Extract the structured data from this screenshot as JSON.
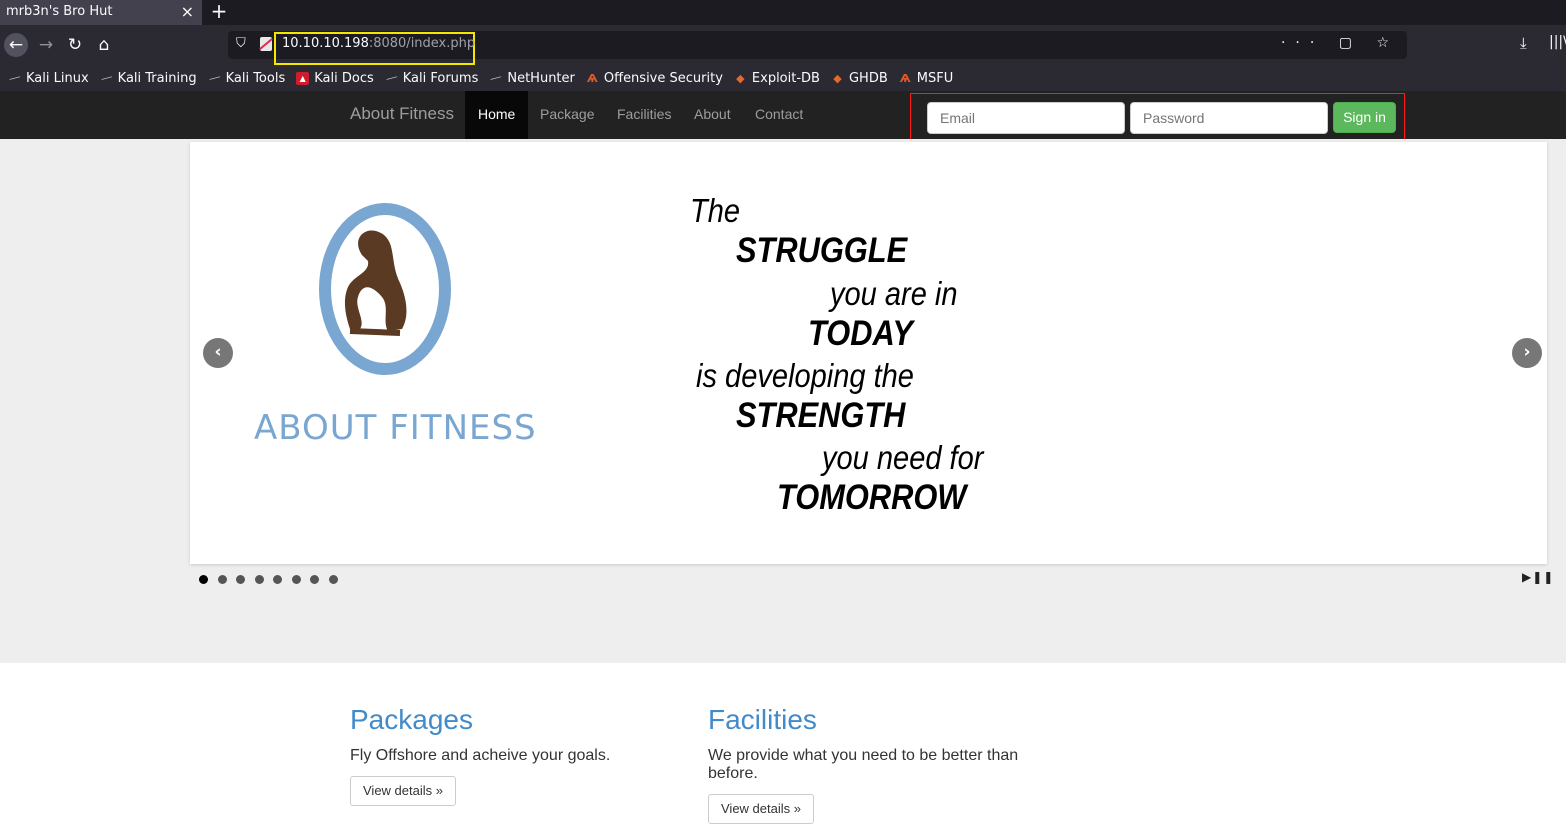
{
  "browser": {
    "tab_title": "mrb3n's Bro Hut",
    "tab_close": "×",
    "new_tab": "+",
    "url_host": "10.10.10.198",
    "url_path": ":8080/index.php",
    "url_actions": "··· ▢ ☆",
    "bookmarks": [
      {
        "label": "Kali Linux",
        "icon": "kali-dragon-icon"
      },
      {
        "label": "Kali Training",
        "icon": "kali-dragon-icon"
      },
      {
        "label": "Kali Tools",
        "icon": "kali-dragon-icon"
      },
      {
        "label": "Kali Docs",
        "icon": "kali-docs-icon"
      },
      {
        "label": "Kali Forums",
        "icon": "kali-dragon-icon"
      },
      {
        "label": "NetHunter",
        "icon": "kali-dragon-icon"
      },
      {
        "label": "Offensive Security",
        "icon": "offsec-icon"
      },
      {
        "label": "Exploit-DB",
        "icon": "exploit-db-icon"
      },
      {
        "label": "GHDB",
        "icon": "exploit-db-icon"
      },
      {
        "label": "MSFU",
        "icon": "offsec-icon"
      }
    ]
  },
  "site": {
    "brand": "About Fitness",
    "nav": [
      "Home",
      "Package",
      "Facilities",
      "About",
      "Contact"
    ],
    "active_nav": "Home",
    "login": {
      "email_placeholder": "Email",
      "password_placeholder": "Password",
      "signin_label": "Sign in"
    }
  },
  "slider": {
    "logo_text": "ABOUT FITNESS",
    "quote_lines": [
      "The",
      "STRUGGLE",
      "you are in",
      "TODAY",
      "is developing the",
      "STRENGTH",
      "you need for",
      "TOMORROW"
    ],
    "prev_arrow": "‹",
    "next_arrow": "›",
    "dot_count": 8,
    "active_dot": 0,
    "play_pause": "▶❚❚"
  },
  "content": {
    "columns": [
      {
        "title": "Packages",
        "text": "Fly Offshore and acheive your goals.",
        "button": "View details »"
      },
      {
        "title": "Facilities",
        "text": "We provide what you need to be better than before.",
        "button": "View details »"
      }
    ]
  },
  "colors": {
    "nav_bg": "#222222",
    "signin_green": "#5cb85c",
    "heading_blue": "#428bca",
    "logo_blue": "#7aa6d2",
    "annotation_red": "#ff1a1a",
    "annotation_yellow": "#f5e600"
  }
}
